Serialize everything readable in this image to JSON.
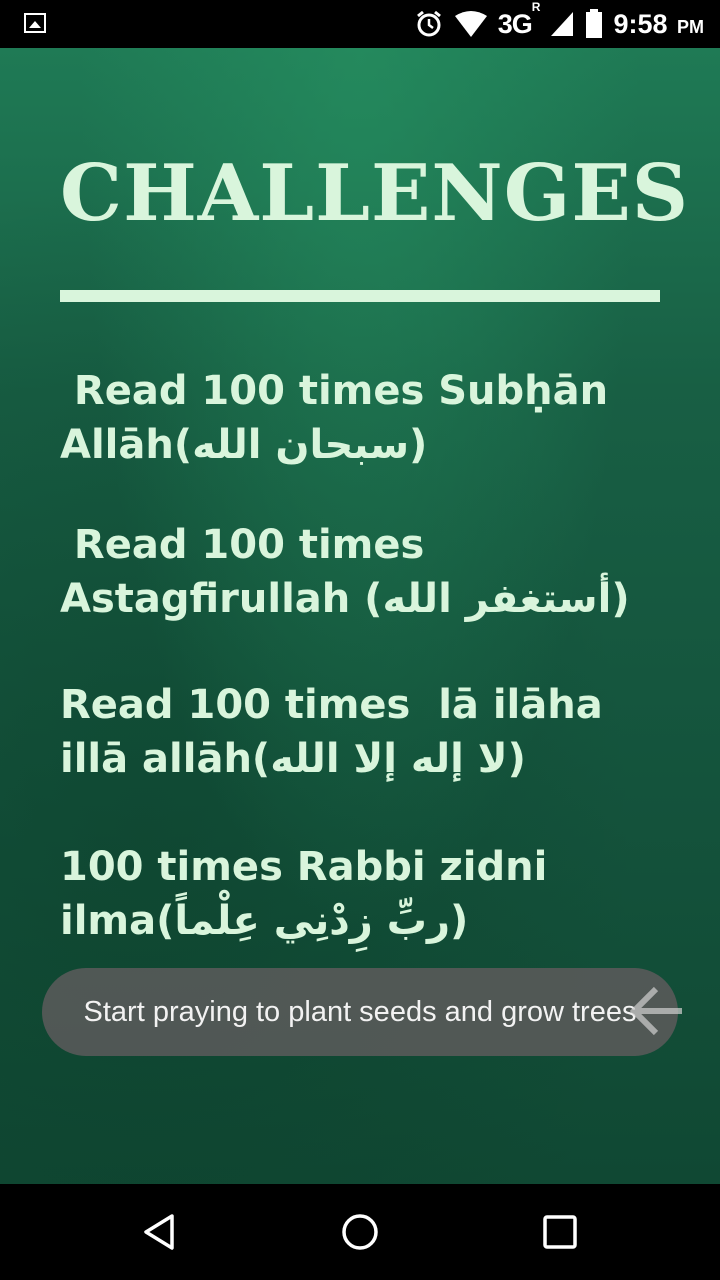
{
  "status_bar": {
    "network": "3G",
    "network_sup": "R",
    "time": "9:58",
    "ampm": "PM",
    "icons": [
      "image-icon",
      "alarm-icon",
      "wifi-icon",
      "signal-icon",
      "battery-icon"
    ]
  },
  "screen": {
    "title": "CHALLENGES",
    "challenges": [
      {
        "line1": " Read 100 times Subḥān",
        "line2": "Allāh(سبحان الله)"
      },
      {
        "line1": " Read 100 times",
        "line2": "Astagfirullah (أستغفر الله)"
      },
      {
        "line1": "Read 100 times  lā ilāha",
        "line2": "illā allāh(لا إله إلا الله)"
      },
      {
        "line1": "100 times Rabbi zidni",
        "line2": "ilma(ربِّ زِدْنِي عِلْماً)"
      }
    ],
    "toast": "Start praying to plant seeds and grow trees"
  },
  "colors": {
    "chalk": "#d9f5dc",
    "board_top": "#1f7a55",
    "board_bottom": "#104833",
    "toast_bg": "#5a5a5a"
  },
  "nav_bar": {
    "icons": [
      "back-triangle-icon",
      "home-circle-icon",
      "recents-square-icon"
    ]
  }
}
